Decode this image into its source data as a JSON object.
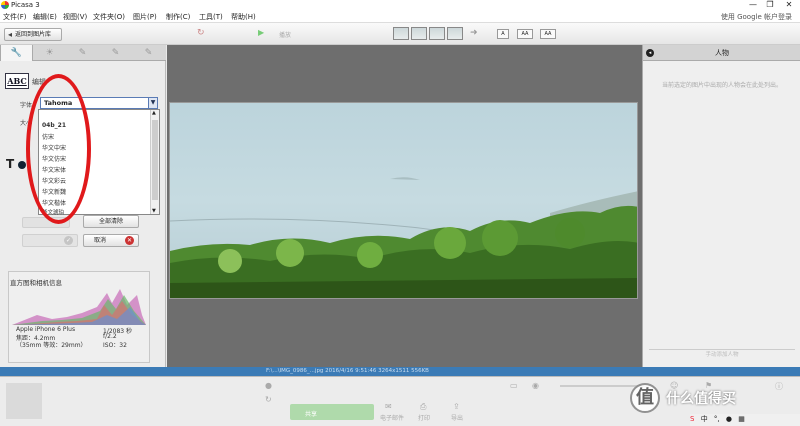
{
  "app": {
    "title": "Picasa 3",
    "window_controls": [
      "—",
      "❐",
      "✕"
    ]
  },
  "menu": {
    "items": [
      "文件(F)",
      "编辑(E)",
      "视图(V)",
      "文件夹(O)",
      "图片(P)",
      "制作(C)",
      "工具(T)",
      "帮助(H)"
    ],
    "login": "使用 Google 帐户登录"
  },
  "toolbar": {
    "back_label": "返回到图片库",
    "play_label": "播放",
    "zoom_buttons": [
      "A",
      "AA",
      "AA"
    ]
  },
  "left_panel": {
    "tab_icons": [
      "wrench-icon",
      "sun-icon",
      "brush-icon",
      "brush-icon",
      "brush-icon"
    ],
    "edit_label": "编辑",
    "abc": "ABC",
    "font_label": "字体",
    "size_label": "大小",
    "font_selected": "Tahoma",
    "font_options": [
      "04b_21",
      "仿宋",
      "华文中宋",
      "华文仿宋",
      "华文宋体",
      "华文彩云",
      "华文新魏",
      "华文楷体",
      "华文琥珀"
    ],
    "clear_all_label": "全部清除",
    "cancel_label": "取消",
    "histogram_title": "直方图和相机信息",
    "camera": {
      "model": "Apple iPhone 6 Plus",
      "focal": "焦距：4.2mm",
      "equiv": "（35mm 等效：29mm）",
      "shutter": "1/2083 秒",
      "aperture": "f/2.2",
      "iso": "ISO：32"
    }
  },
  "right_panel": {
    "title": "人物",
    "description": "当前选定的图片中出现的人物会在此处列出。",
    "add_label": "手动添加人物"
  },
  "status": {
    "text": "F:\\...\\IMG_0986_...jpg     2016/4/16 9:51:46     3264x1511     556KB"
  },
  "tray": {
    "share_label": "共享",
    "email_label": "电子邮件",
    "print_label": "打印",
    "export_label": "导出"
  },
  "watermark": {
    "symbol": "值",
    "text": "什么值得买"
  },
  "colors": {
    "status_bar": "#3b7bb6",
    "annotation": "#e0191b",
    "canvas": "#6e6e6e"
  }
}
